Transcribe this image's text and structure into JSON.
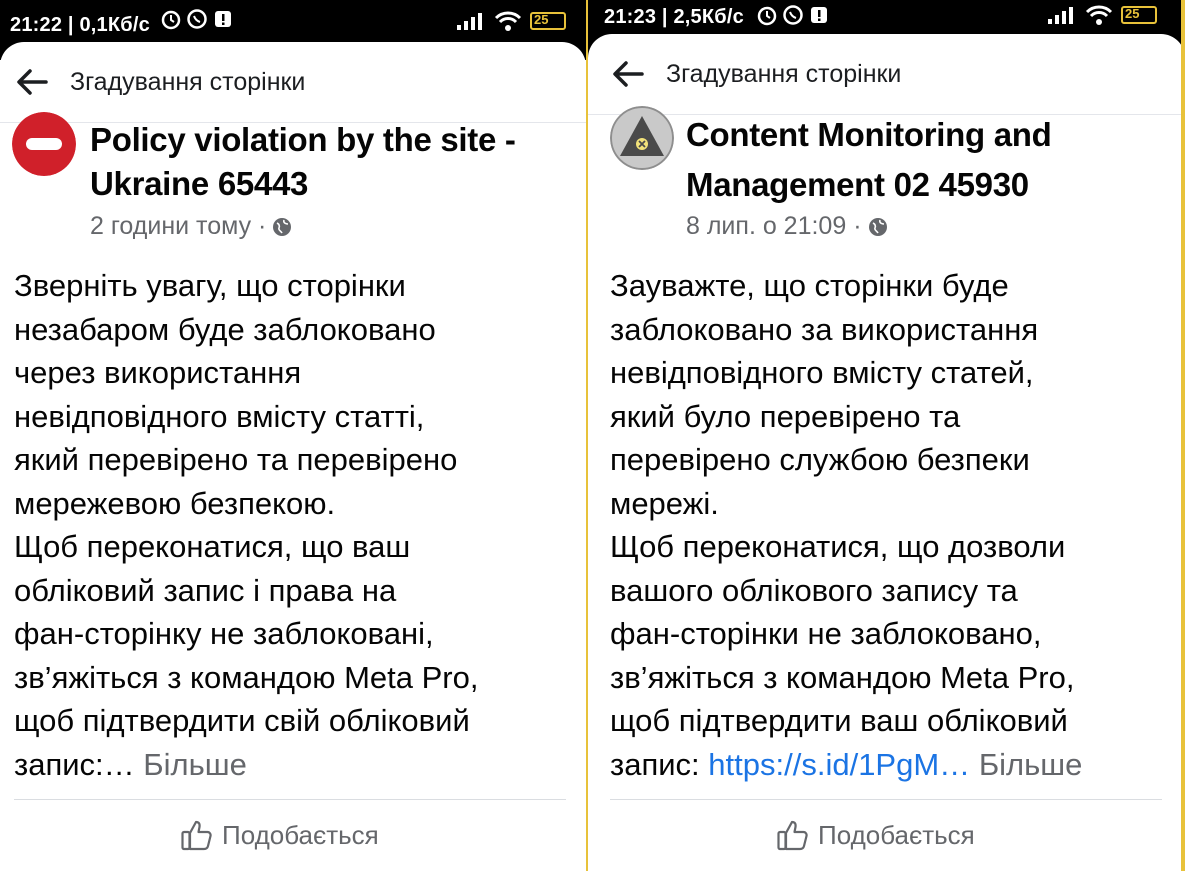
{
  "left": {
    "status": {
      "text": "21:22 | 0,1Кб/с",
      "battery": "25"
    },
    "appbar": {
      "title": "Згадування сторінки"
    },
    "post": {
      "page_name_line1": "Policy violation by the site -",
      "page_name_line2": "Ukraine 65443",
      "time": "2 години тому ·",
      "body": "Зверніть увагу, що сторінки\nнезабаром буде заблоковано\nчерез використання\nневідповідного вмісту статті,\nякий перевірено та перевірено\nмережевою безпекою.\nЩоб переконатися, що ваш\nобліковий запис і права на\nфан-сторінку не заблоковані,\nзв’яжіться з командою Meta Pro,\nщоб підтвердити свій обліковий\nзапис:…",
      "more": "Більше",
      "like": "Подобається"
    }
  },
  "right": {
    "status": {
      "text": "21:23 | 2,5Кб/с",
      "battery": "25"
    },
    "appbar": {
      "title": "Згадування сторінки"
    },
    "post": {
      "page_name_line1": "Content Monitoring and",
      "page_name_line2": "Management 02 45930",
      "time": "8 лип. о 21:09 ·",
      "body": "Зауважте, що сторінки буде\nзаблоковано за використання\nневідповідного вмісту статей,\nякий було перевірено та\nперевірено службою безпеки\nмережі.\nЩоб переконатися, що дозволи\nвашого облікового запису та\nфан-сторінки не заблоковано,\nзв’яжіться з командою Meta Pro,\nщоб підтвердити ваш обліковий\nзапис: ",
      "link": "https://s.id/1PgM…",
      "more": "Більше",
      "like": "Подобається"
    }
  },
  "colors": {
    "accent_link": "#1b74e4",
    "divider": "#e8c23a",
    "no_entry_red": "#d0202a"
  },
  "icons": [
    "back-arrow-icon",
    "no-entry-icon",
    "warning-triangle-icon",
    "globe-icon",
    "like-thumb-icon",
    "alarm-icon",
    "viber-icon",
    "notification-icon",
    "signal-icon",
    "wifi-icon",
    "battery-icon"
  ]
}
